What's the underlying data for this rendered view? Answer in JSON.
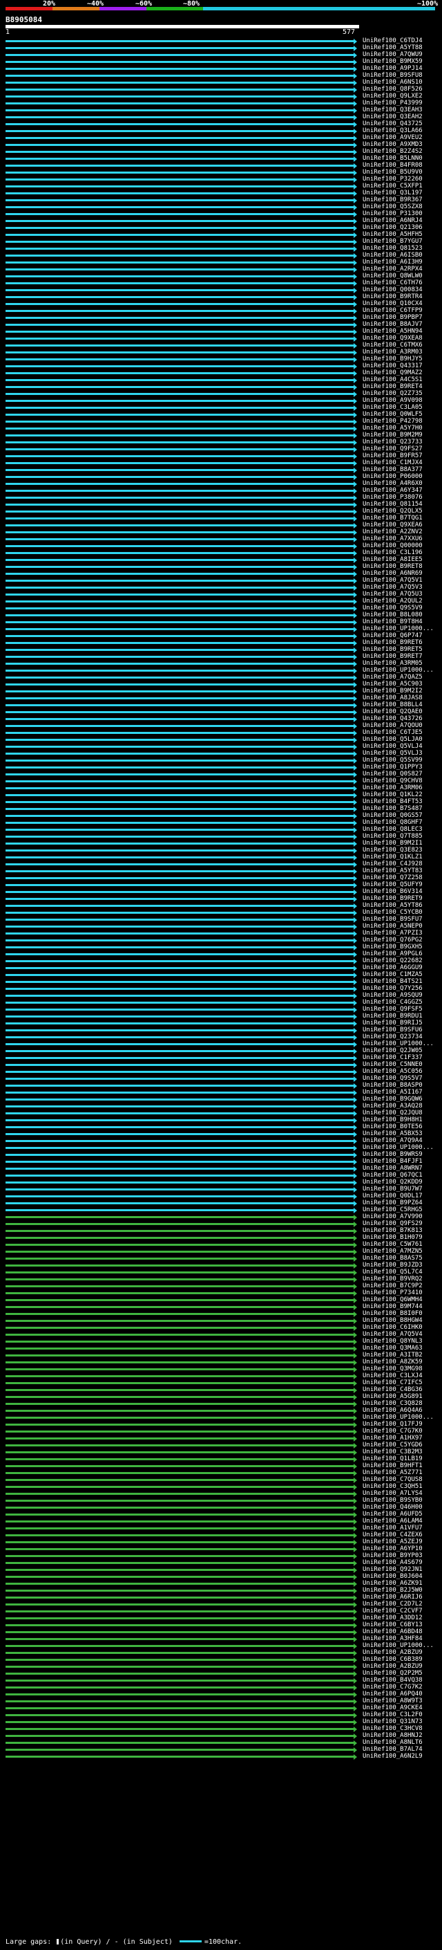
{
  "scale": {
    "labels": [
      "20%",
      "~40%",
      "~60%",
      "~80%",
      "~100%"
    ],
    "colors": [
      "#e01b1b",
      "#e07b1b",
      "#a020f0",
      "#1bb01b",
      "#22c8e0"
    ]
  },
  "query": {
    "id": "B8905084",
    "start": "1",
    "end": "577"
  },
  "hit_colors": {
    "cyan": "#2fd5ee",
    "green": "#3fb43f"
  },
  "hits": [
    "UniRef100_C6TDJ4",
    "UniRef100_A5YT88",
    "UniRef100_A7QWU9",
    "UniRef100_B9MX59",
    "UniRef100_A9PJ14",
    "UniRef100_B9SFU8",
    "UniRef100_A6NS10",
    "UniRef100_Q8F526",
    "UniRef100_Q9LXE2",
    "UniRef100_P43999",
    "UniRef100_Q3EAH3",
    "UniRef100_Q3EAH2",
    "UniRef100_Q43725",
    "UniRef100_Q3LA66",
    "UniRef100_A9VEU2",
    "UniRef100_A9XMD3",
    "UniRef100_B2Z4S2",
    "UniRef100_B5LNN0",
    "UniRef100_B4FR08",
    "UniRef100_B5U9V0",
    "UniRef100_P32260",
    "UniRef100_C5XFP1",
    "UniRef100_Q3L197",
    "UniRef100_B9R367",
    "UniRef100_Q5SZX8",
    "UniRef100_P31300",
    "UniRef100_A6NRJ4",
    "UniRef100_Q21306",
    "UniRef100_A5HFH5",
    "UniRef100_B7YGU7",
    "UniRef100_Q81523",
    "UniRef100_A6ISB0",
    "UniRef100_A6I3H9",
    "UniRef100_A2RPX4",
    "UniRef100_Q8WLW0",
    "UniRef100_C6TH76",
    "UniRef100_Q00834",
    "UniRef100_B9RTR4",
    "UniRef100_Q10CX4",
    "UniRef100_C6TFP9",
    "UniRef100_B9PBP7",
    "UniRef100_B8AJV7",
    "UniRef100_A5HN94",
    "UniRef100_Q9XEA8",
    "UniRef100_C6TMX6",
    "UniRef100_A3RM03",
    "UniRef100_B9HJY5",
    "UniRef100_Q43317",
    "UniRef100_Q9MAZ2",
    "UniRef100_A4C5S1",
    "UniRef100_B9RET4",
    "UniRef100_Q2Z735",
    "UniRef100_A9V098",
    "UniRef100_C3LA05",
    "UniRef100_Q0WLF5",
    "UniRef100_P42798",
    "UniRef100_A5Y7H0",
    "UniRef100_B9M2M9",
    "UniRef100_Q23733",
    "UniRef100_Q9FS27",
    "UniRef100_B9FR57",
    "UniRef100_C1MJX4",
    "UniRef100_B8A377",
    "UniRef100_P06000",
    "UniRef100_A4R6X0",
    "UniRef100_A6Y347",
    "UniRef100_P38076",
    "UniRef100_Q81154",
    "UniRef100_Q2QLX5",
    "UniRef100_B7TQG1",
    "UniRef100_Q9XEA6",
    "UniRef100_A2ZNV2",
    "UniRef100_A7XXU6",
    "UniRef100_Q00000",
    "UniRef100_C3L196",
    "UniRef100_A8IEE5",
    "UniRef100_B9RET8",
    "UniRef100_A6NR69",
    "UniRef100_A7Q5V1",
    "UniRef100_A7Q5V3",
    "UniRef100_A7Q5U3",
    "UniRef100_A2QUL2",
    "UniRef100_Q9S5V9",
    "UniRef100_B8L080",
    "UniRef100_B9T8H4",
    "UniRef100_UP1000...",
    "UniRef100_Q6P747",
    "UniRef100_B9RET6",
    "UniRef100_B9RET5",
    "UniRef100_B9RET7",
    "UniRef100_A3RM05",
    "UniRef100_UP1000...",
    "UniRef100_A7QAZ5",
    "UniRef100_A5C903",
    "UniRef100_B9M2I2",
    "UniRef100_A8JAS8",
    "UniRef100_B8BLL4",
    "UniRef100_Q2QAE0",
    "UniRef100_Q43726",
    "UniRef100_A7QOU0",
    "UniRef100_C6TJE5",
    "UniRef100_Q5LJA0",
    "UniRef100_Q5VLJ4",
    "UniRef100_Q5VLJ3",
    "UniRef100_Q5SV99",
    "UniRef100_Q1PPY3",
    "UniRef100_Q0S827",
    "UniRef100_Q9CHV8",
    "UniRef100_A3RM06",
    "UniRef100_Q1KL22",
    "UniRef100_B4FT53",
    "UniRef100_B7S487",
    "UniRef100_Q0GS57",
    "UniRef100_Q8GHF7",
    "UniRef100_Q8LEC3",
    "UniRef100_Q7T885",
    "UniRef100_B9M2I1",
    "UniRef100_Q3E823",
    "UniRef100_Q1KLZ1",
    "UniRef100_C4J928",
    "UniRef100_A5YT83",
    "UniRef100_Q7Z258",
    "UniRef100_Q5UFY9",
    "UniRef100_B6V314",
    "UniRef100_B9RET9",
    "UniRef100_A5YT86",
    "UniRef100_C5YCB0",
    "UniRef100_B9SFU7",
    "UniRef100_A5NEP0",
    "UniRef100_A7PZI3",
    "UniRef100_Q76PG2",
    "UniRef100_B9GXH5",
    "UniRef100_A9PGL6",
    "UniRef100_Q22682",
    "UniRef100_A6GGU9",
    "UniRef100_C1MZA5",
    "UniRef100_B4TS21",
    "UniRef100_Q7Y256",
    "UniRef100_A9SQU9",
    "UniRef100_C4GGZ5",
    "UniRef100_Q9FSF5",
    "UniRef100_B9RDU1",
    "UniRef100_B9RIJ5",
    "UniRef100_B9SFU6",
    "UniRef100_Q23734",
    "UniRef100_UP1000...",
    "UniRef100_Q2JW05",
    "UniRef100_C1F337",
    "UniRef100_C5NNE0",
    "UniRef100_A5C056",
    "UniRef100_Q9S5V7",
    "UniRef100_B8ASP0",
    "UniRef100_A5I167",
    "UniRef100_B9GQW6",
    "UniRef100_A3AQ28",
    "UniRef100_Q2JQU8",
    "UniRef100_B9H8H1",
    "UniRef100_B0TE56",
    "UniRef100_A5BX53",
    "UniRef100_A7Q9A4",
    "UniRef100_UP1000...",
    "UniRef100_B9WRS9",
    "UniRef100_B4FJF1",
    "UniRef100_A8WRN7",
    "UniRef100_Q67QC1",
    "UniRef100_Q2KDD9",
    "UniRef100_B9U7W7",
    "UniRef100_Q0DL17",
    "UniRef100_B9PZ64",
    "UniRef100_C5RHG5",
    "UniRef100_A7V990",
    "UniRef100_Q9FS29",
    "UniRef100_B7K813",
    "UniRef100_B1H079",
    "UniRef100_C5W761",
    "UniRef100_A7MZN5",
    "UniRef100_B8AS75",
    "UniRef100_B9JZD3",
    "UniRef100_Q5L7C4",
    "UniRef100_B9VRQ2",
    "UniRef100_B7C9P2",
    "UniRef100_P73410",
    "UniRef100_Q6WMH4",
    "UniRef100_B9M744",
    "UniRef100_B8I0F0",
    "UniRef100_B8HGW4",
    "UniRef100_C6IHK0",
    "UniRef100_A7Q5V4",
    "UniRef100_Q8YNL3",
    "UniRef100_Q3MA63",
    "UniRef100_A3ITB2",
    "UniRef100_A8ZK59",
    "UniRef100_Q3MG98",
    "UniRef100_C3LXJ4",
    "UniRef100_C7IFC5",
    "UniRef100_C4BG36",
    "UniRef100_A5G891",
    "UniRef100_C3Q828",
    "UniRef100_A6Q4A6",
    "UniRef100_UP1000...",
    "UniRef100_Q17FJ9",
    "UniRef100_C7G7K0",
    "UniRef100_A1HX97",
    "UniRef100_C5YGD6",
    "UniRef100_C3B2M3",
    "UniRef100_Q1LB19",
    "UniRef100_B9HFT1",
    "UniRef100_A5Z771",
    "UniRef100_C7QUS8",
    "UniRef100_C3QH51",
    "UniRef100_A7LYS4",
    "UniRef100_B9SYB0",
    "UniRef100_Q46H00",
    "UniRef100_A6UFD5",
    "UniRef100_A6LAM4",
    "UniRef100_A1VFU7",
    "UniRef100_C4ZEX6",
    "UniRef100_A5ZEJ9",
    "UniRef100_A6YP10",
    "UniRef100_B9YP03",
    "UniRef100_A4S679",
    "UniRef100_Q92JN1",
    "UniRef100_B0J604",
    "UniRef100_A6ZK91",
    "UniRef100_B2J5W0",
    "UniRef100_A6RIJ6",
    "UniRef100_C2D7L2",
    "UniRef100_C2CVF7",
    "UniRef100_A3DD12",
    "UniRef100_C6BY13",
    "UniRef100_A6BD48",
    "UniRef100_A3HF84",
    "UniRef100_UP1000...",
    "UniRef100_A2BZU9",
    "UniRef100_C6B389",
    "UniRef100_A2BZU9",
    "UniRef100_Q2P2M5",
    "UniRef100_B4VQ38",
    "UniRef100_C7G7K2",
    "UniRef100_A6PQ40",
    "UniRef100_A8W9T3",
    "UniRef100_A9CKE4",
    "UniRef100_C3L2F0",
    "UniRef100_Q31N73",
    "UniRef100_C3HCV8",
    "UniRef100_A8HNJ2",
    "UniRef100_A8NLT6",
    "UniRef100_B7AL74",
    "UniRef100_A6N2L9"
  ],
  "legend": {
    "prefix": "Large gaps:",
    "query_gap": "(in Query)",
    "separator": "/",
    "subject_gap": "(in Subject)",
    "scale_text": "=100char."
  }
}
